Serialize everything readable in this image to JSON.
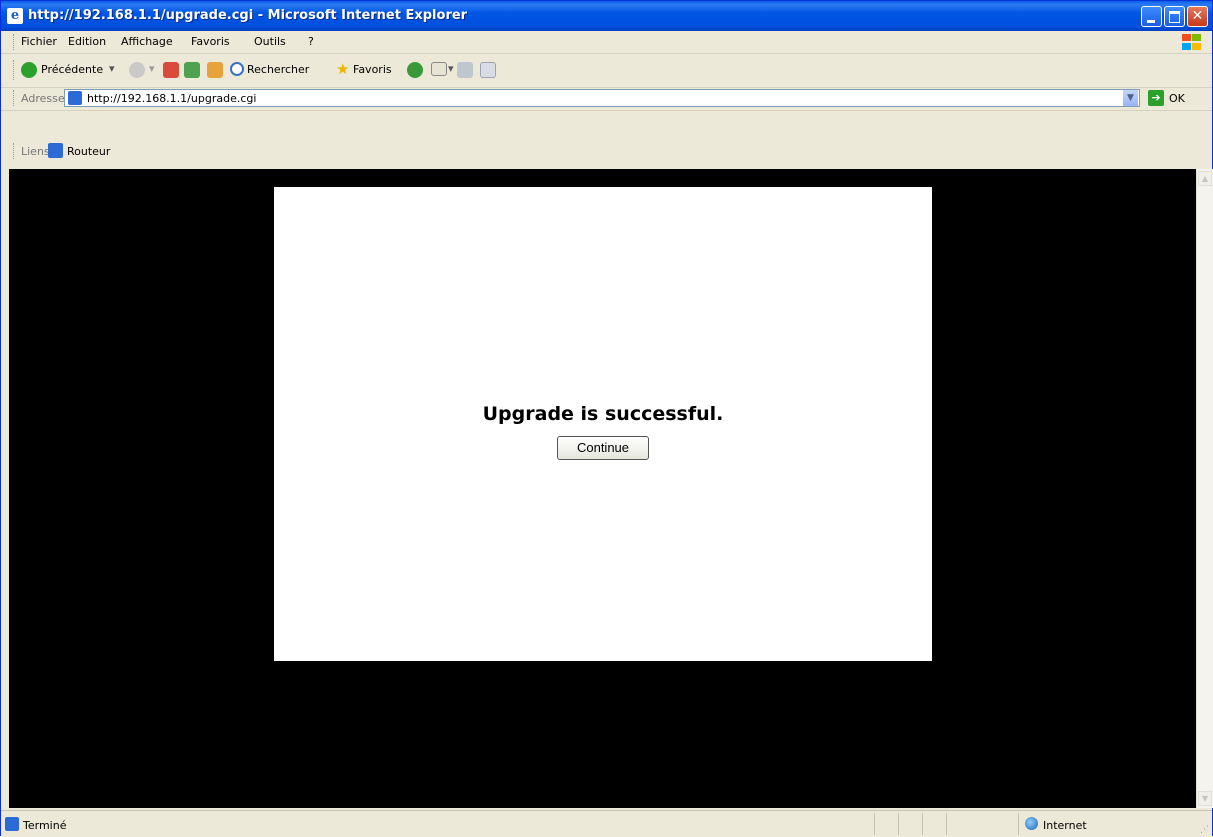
{
  "window": {
    "title": "http://192.168.1.1/upgrade.cgi - Microsoft Internet Explorer"
  },
  "menu": {
    "items": [
      {
        "label": "Fichier"
      },
      {
        "label": "Edition"
      },
      {
        "label": "Affichage"
      },
      {
        "label": "Favoris"
      },
      {
        "label": "Outils"
      },
      {
        "label": "?"
      }
    ]
  },
  "toolbar": {
    "back_label": "Précédente",
    "search_label": "Rechercher",
    "favorites_label": "Favoris"
  },
  "address": {
    "label": "Adresse",
    "url": "http://192.168.1.1/upgrade.cgi",
    "go_label": "OK"
  },
  "links": {
    "label": "Liens",
    "items": [
      {
        "label": "Routeur"
      }
    ]
  },
  "page": {
    "message": "Upgrade is successful.",
    "continue_label": "Continue"
  },
  "status": {
    "text": "Terminé",
    "zone": "Internet"
  }
}
